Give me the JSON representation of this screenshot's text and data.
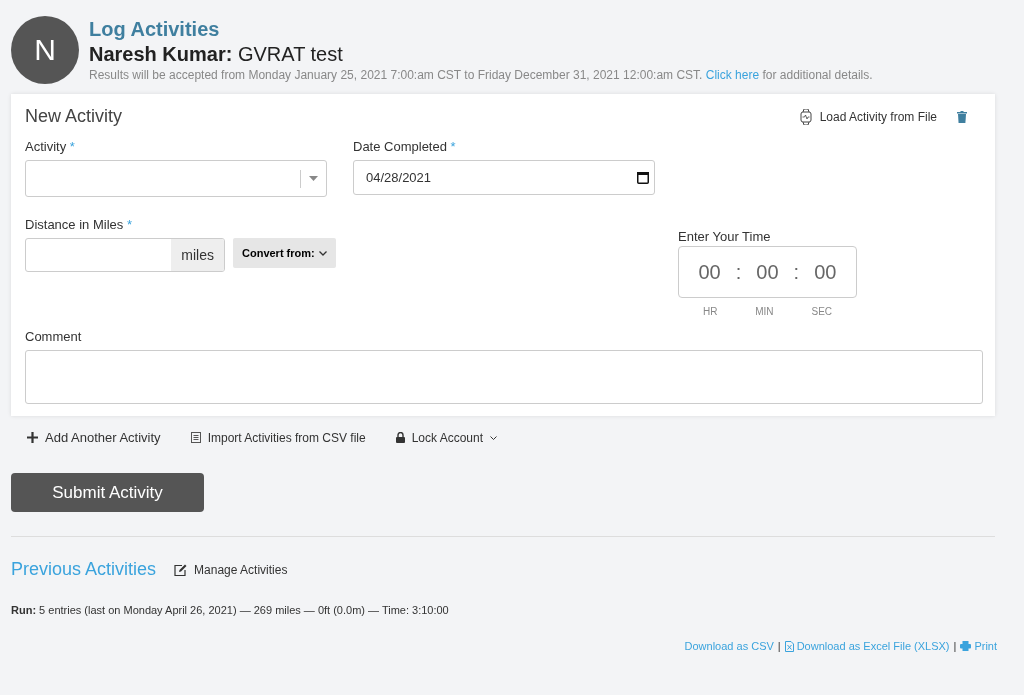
{
  "header": {
    "avatar_letter": "N",
    "title": "Log Activities",
    "user_name": "Naresh Kumar:",
    "event": "GVRAT test",
    "notice_before": "Results will be accepted from Monday January 25, 2021 7:00:am CST to Friday December 31, 2021 12:00:am CST.",
    "notice_link": "Click here",
    "notice_after": "for additional details."
  },
  "form": {
    "title": "New Activity",
    "load_button": "Load Activity from File",
    "activity": {
      "label": "Activity",
      "required_mark": "*"
    },
    "date": {
      "label": "Date Completed",
      "required_mark": "*",
      "value": "04/28/2021"
    },
    "distance": {
      "label": "Distance in Miles",
      "required_mark": "*",
      "unit": "miles",
      "convert": "Convert from:"
    },
    "time": {
      "label": "Enter Your Time",
      "parts": [
        {
          "value": "00",
          "unit": "HR"
        },
        {
          "value": "00",
          "unit": "MIN"
        },
        {
          "value": "00",
          "unit": "SEC"
        }
      ],
      "separator": ":"
    },
    "comment": {
      "label": "Comment"
    }
  },
  "actions": [
    {
      "kind": "add",
      "label": "Add Another Activity"
    },
    {
      "kind": "import",
      "label": "Import Activities from CSV file"
    },
    {
      "kind": "lock",
      "label": "Lock Account"
    }
  ],
  "submit": "Submit Activity",
  "previous": {
    "title": "Previous Activities",
    "manage": "Manage Activities",
    "summary": "**Run:** 5 entries (last on Monday April 26, 2021) — 269 miles — 0ft (0.0m) — Time: 3:10:00"
  },
  "downloads": {
    "separator": "|",
    "items": [
      {
        "kind": "csv",
        "label": "Download as CSV"
      },
      {
        "kind": "xlsx",
        "label": "Download as Excel File (XLSX)"
      },
      {
        "kind": "print",
        "label": "Print"
      }
    ]
  }
}
